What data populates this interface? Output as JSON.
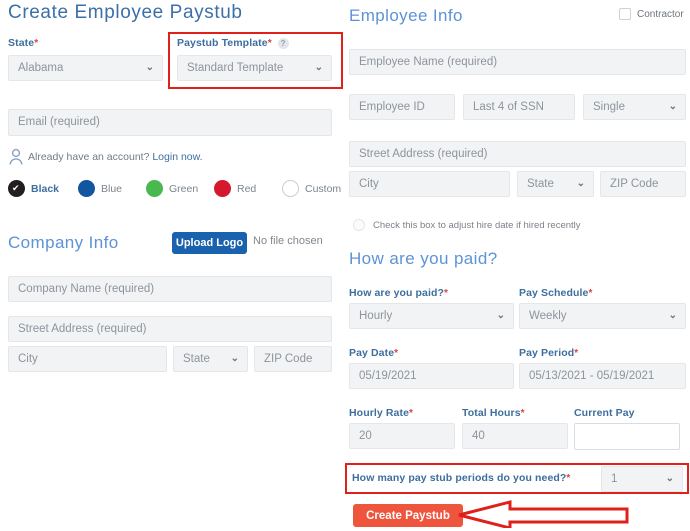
{
  "page_title": "Create Employee Paystub",
  "colors": {
    "title_blue": "#3c6fa8",
    "section_blue": "#5d93d6",
    "label_blue": "#3d6e9e",
    "required_red": "#e0403f",
    "annotation_red": "#e0201b",
    "upload_button_blue": "#1a62ae",
    "create_button_orange": "#ef553c",
    "swatch_black": "#231f20",
    "swatch_blue": "#1255a0",
    "swatch_green": "#49b94f",
    "swatch_red": "#d5192c"
  },
  "left": {
    "state": {
      "label": "State",
      "required": "*",
      "value": "Alabama"
    },
    "paystub_template": {
      "label": "Paystub Template",
      "required": "*",
      "help_icon": "question-mark-icon",
      "value": "Standard Template"
    },
    "email": {
      "placeholder": "Email (required)"
    },
    "account_line": {
      "icon": "user-icon",
      "text": "Already have an account?",
      "link": "Login now."
    },
    "color_options": [
      {
        "name": "Black",
        "hex": "#231f20",
        "selected": true
      },
      {
        "name": "Blue",
        "hex": "#1255a0",
        "selected": false
      },
      {
        "name": "Green",
        "hex": "#49b94f",
        "selected": false
      },
      {
        "name": "Red",
        "hex": "#d5192c",
        "selected": false
      },
      {
        "name": "Custom",
        "hex": "#ffffff",
        "selected": false
      }
    ],
    "company_info": {
      "title": "Company Info",
      "upload_button": "Upload Logo",
      "file_status": "No file chosen",
      "company_name": {
        "placeholder": "Company Name (required)"
      },
      "street_address": {
        "placeholder": "Street Address (required)"
      },
      "city": {
        "placeholder": "City"
      },
      "state": {
        "placeholder": "State"
      },
      "zip": {
        "placeholder": "ZIP Code"
      }
    }
  },
  "right": {
    "employee_info": {
      "title": "Employee Info",
      "contractor_label": "Contractor",
      "contractor_checked": false,
      "employee_name": {
        "placeholder": "Employee Name (required)"
      },
      "employee_id": {
        "placeholder": "Employee ID"
      },
      "last4_ssn": {
        "placeholder": "Last 4 of SSN"
      },
      "marital_status": {
        "value": "Single"
      },
      "street_address": {
        "placeholder": "Street Address (required)"
      },
      "city": {
        "placeholder": "City"
      },
      "state": {
        "placeholder": "State"
      },
      "zip": {
        "placeholder": "ZIP Code"
      },
      "hire_date_checkbox": {
        "label": "Check this box to adjust hire date if hired recently",
        "checked": false
      }
    },
    "pay_section": {
      "title": "How are you paid?",
      "how_paid": {
        "label": "How are you paid?",
        "required": "*",
        "value": "Hourly"
      },
      "pay_schedule": {
        "label": "Pay Schedule",
        "required": "*",
        "value": "Weekly"
      },
      "pay_date": {
        "label": "Pay Date",
        "required": "*",
        "value": "05/19/2021"
      },
      "pay_period": {
        "label": "Pay Period",
        "required": "*",
        "value": "05/13/2021 - 05/19/2021"
      },
      "hourly_rate": {
        "label": "Hourly Rate",
        "required": "*",
        "value": "20"
      },
      "total_hours": {
        "label": "Total Hours",
        "required": "*",
        "value": "40"
      },
      "current_pay": {
        "label": "Current Pay",
        "required": "",
        "value": ""
      },
      "periods": {
        "label": "How many pay stub periods do you need?",
        "required": "*",
        "value": "1"
      },
      "create_button": "Create Paystub"
    }
  }
}
